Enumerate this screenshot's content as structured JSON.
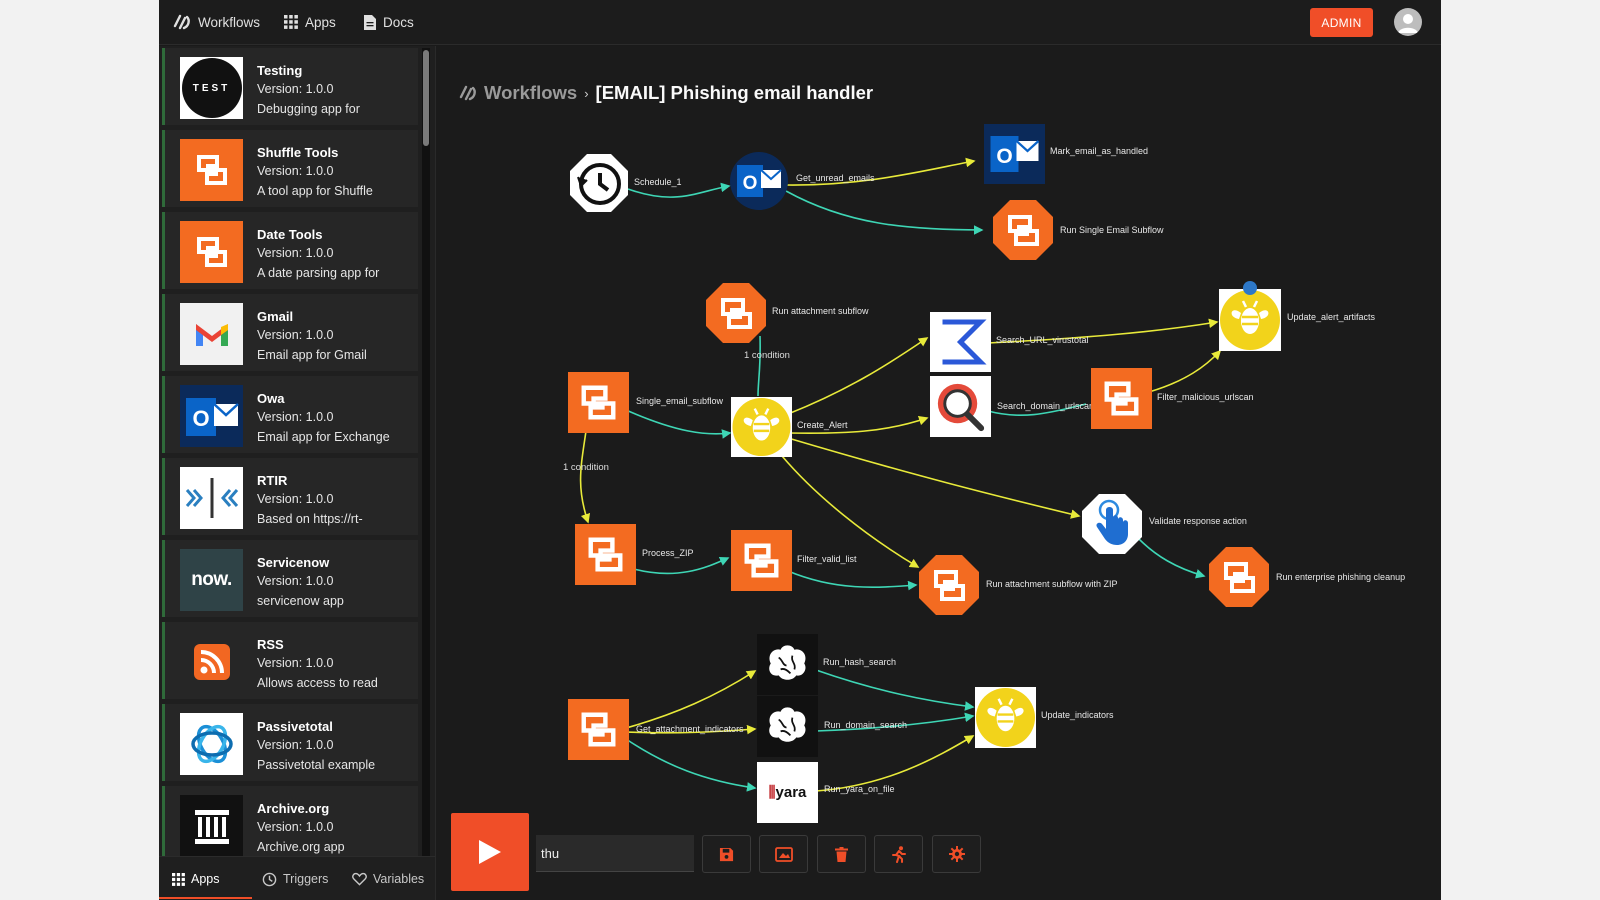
{
  "nav": {
    "workflows": "Workflows",
    "apps": "Apps",
    "docs": "Docs",
    "admin": "ADMIN"
  },
  "apps": [
    {
      "name": "Testing",
      "version": "Version: 1.0.0",
      "desc": "Debugging app for",
      "icon": "test-logo",
      "icon_text": "TEST"
    },
    {
      "name": "Shuffle Tools",
      "version": "Version: 1.0.0",
      "desc": "A tool app for Shuffle",
      "icon": "shuffle-logo"
    },
    {
      "name": "Date Tools",
      "version": "Version: 1.0.0",
      "desc": "A date parsing app for",
      "icon": "shuffle-logo"
    },
    {
      "name": "Gmail",
      "version": "Version: 1.0.0",
      "desc": "Email app for Gmail",
      "icon": "gmail-logo"
    },
    {
      "name": "Owa",
      "version": "Version: 1.0.0",
      "desc": "Email app for Exchange",
      "icon": "outlook-logo"
    },
    {
      "name": "RTIR",
      "version": "Version: 1.0.0",
      "desc": "Based on https://rt-",
      "icon": "rtir-logo"
    },
    {
      "name": "Servicenow",
      "version": "Version: 1.0.0",
      "desc": "servicenow app",
      "icon": "servicenow-logo",
      "icon_text": "now."
    },
    {
      "name": "RSS",
      "version": "Version: 1.0.0",
      "desc": "Allows access to read",
      "icon": "rss-logo"
    },
    {
      "name": "Passivetotal",
      "version": "Version: 1.0.0",
      "desc": "Passivetotal example",
      "icon": "passivetotal-logo"
    },
    {
      "name": "Archive.org",
      "version": "Version: 1.0.0",
      "desc": "Archive.org app",
      "icon": "archive-logo"
    }
  ],
  "tabs": {
    "apps": "Apps",
    "triggers": "Triggers",
    "variables": "Variables"
  },
  "breadcrumb": {
    "root": "Workflows",
    "separator": "›",
    "title": "[EMAIL] Phishing email handler"
  },
  "nodes": {
    "schedule": "Schedule_1",
    "get_unread": "Get_unread_emails",
    "mark_handled": "Mark_email_as_handled",
    "run_single": "Run Single Email Subflow",
    "run_attachment": "Run attachment subflow",
    "search_url": "Search_URL_virustotal",
    "update_artifacts": "Update_alert_artifacts",
    "single_email": "Single_email_subflow",
    "create_alert": "Create_Alert",
    "search_domain": "Search_domain_urlscan",
    "filter_malicious": "Filter_malicious_urlscan",
    "validate": "Validate response action",
    "process_zip": "Process_ZIP",
    "filter_valid": "Filter_valid_list",
    "run_attachment_zip": "Run attachment subflow with ZIP",
    "run_enterprise": "Run enterprise phishing cleanup",
    "run_hash": "Run_hash_search",
    "get_attachment": "Get_attachment_indicators",
    "run_domain": "Run_domain_search",
    "update_indicators": "Update_indicators",
    "run_yara": "Run_yara_on_file"
  },
  "conditions": {
    "c1": "1 condition",
    "c2": "1 condition"
  },
  "icons": {
    "yara_text": "yara"
  },
  "toolbar": {
    "execution_arg": "thu"
  },
  "colors": {
    "accent": "#f04e28",
    "edge_yellow": "#e8ea3a",
    "edge_teal": "#3ed6b5",
    "hive_yellow": "#f2d31b"
  }
}
